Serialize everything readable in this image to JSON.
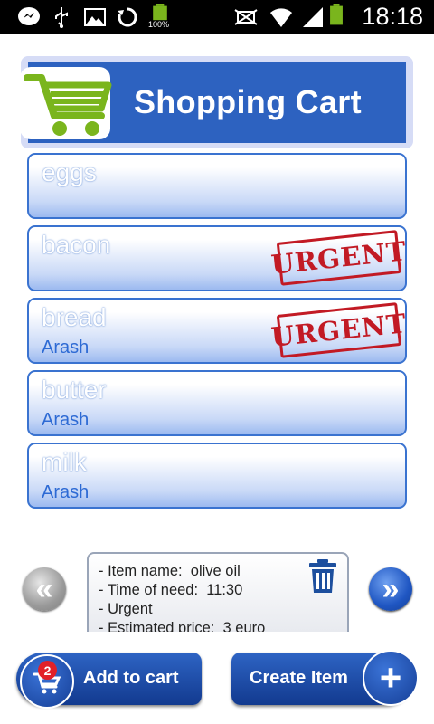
{
  "status_bar": {
    "time": "18:18",
    "battery_label": "100%",
    "icons": [
      "messenger-icon",
      "usb-icon",
      "image-icon",
      "sync-icon",
      "battery-full-icon",
      "nfc-icon",
      "wifi-icon",
      "signal-icon",
      "battery-icon"
    ]
  },
  "header": {
    "title": "Shopping Cart",
    "logo_icon": "shopping-cart-icon"
  },
  "items": [
    {
      "name": "eggs",
      "owner": "",
      "urgent": false
    },
    {
      "name": "bacon",
      "owner": "",
      "urgent": true
    },
    {
      "name": "bread",
      "owner": "Arash",
      "urgent": true
    },
    {
      "name": "butter",
      "owner": "Arash",
      "urgent": false
    },
    {
      "name": "milk",
      "owner": "Arash",
      "urgent": false
    }
  ],
  "urgent_label": "URGENT",
  "detail": {
    "line1": "- Item name:  olive oil",
    "line2": "- Time of need:  11:30",
    "line3": "- Urgent",
    "line4": "- Estimated price:  3 euro"
  },
  "carousel": {
    "prev_icon": "chevron-double-left-icon",
    "next_icon": "chevron-double-right-icon",
    "prev_glyph": "«",
    "next_glyph": "»"
  },
  "buttons": {
    "add_to_cart": "Add to cart",
    "cart_count": "2",
    "create_item": "Create Item",
    "plus_glyph": "+"
  },
  "colors": {
    "accent": "#2d62c0",
    "urgent_red": "#c21a24",
    "owner_blue": "#2d6ad4"
  }
}
